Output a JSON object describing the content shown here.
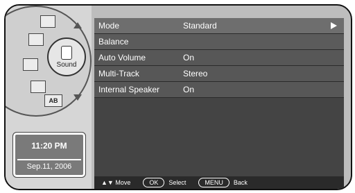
{
  "left_nav": {
    "dial_segments": [
      {
        "name": "picture",
        "label": ""
      },
      {
        "name": "sound",
        "label": ""
      },
      {
        "name": "channel",
        "label": ""
      },
      {
        "name": "timer",
        "label": ""
      },
      {
        "name": "ab",
        "label": "AB"
      }
    ],
    "center_label": "Sound"
  },
  "clock": {
    "time": "11:20 PM",
    "date": "Sep.11, 2006"
  },
  "menu": {
    "rows": [
      {
        "label": "Mode",
        "value": "Standard"
      },
      {
        "label": "Balance",
        "value": ""
      },
      {
        "label": "Auto Volume",
        "value": "On"
      },
      {
        "label": "Multi-Track",
        "value": "Stereo"
      },
      {
        "label": "Internal Speaker",
        "value": "On"
      }
    ]
  },
  "footer": {
    "move": "▲▼ Move",
    "ok": "OK",
    "select": "Select",
    "menu": "MENU",
    "back": "Back"
  },
  "colors": {
    "panel_bg": "#444444",
    "row_sel": "#6e6e6e",
    "clock_bg": "#7a7a7a"
  }
}
